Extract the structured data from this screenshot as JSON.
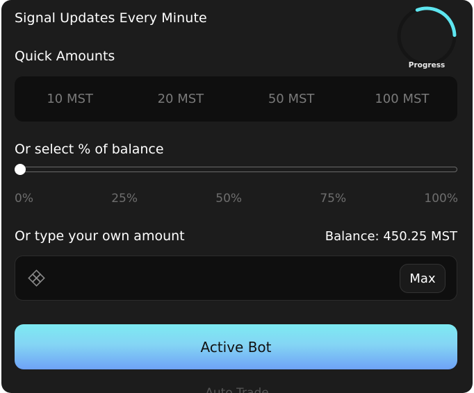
{
  "header": {
    "title": "Signal Updates Every Minute",
    "progress_label": "Progress",
    "progress_fraction": 0.3
  },
  "quick_amounts": {
    "label": "Quick Amounts",
    "items": [
      "10 MST",
      "20 MST",
      "50 MST",
      "100 MST"
    ]
  },
  "percent": {
    "label": "Or select % of balance",
    "value_fraction": 0,
    "ticks": [
      "0%",
      "25%",
      "50%",
      "75%",
      "100%"
    ]
  },
  "custom_amount": {
    "label": "Or type your own amount",
    "balance": "Balance: 450.25 MST",
    "input_value": "",
    "max_label": "Max"
  },
  "actions": {
    "active_bot_label": "Active Bot",
    "footer_hint": "Auto Trade"
  },
  "colors": {
    "background": "#1c1c1c",
    "accent": "#5ee6f0",
    "button_gradient_top": "#7deaf2",
    "button_gradient_bottom": "#6ea2f6"
  }
}
